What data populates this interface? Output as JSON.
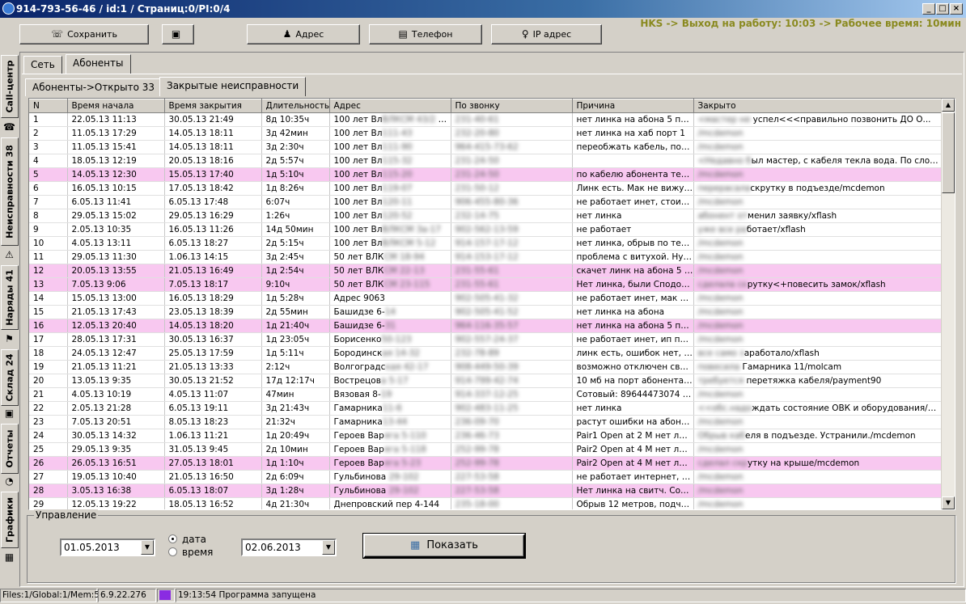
{
  "window": {
    "title": "914-793-56-46 / id:1 / Страниц:0/PI:0/4",
    "hks": "HKS -> Выход на работу: 10:03 -> Рабочее время: 10мин"
  },
  "toolbar": {
    "save": "Сохранить",
    "address": "Адрес",
    "phone": "Телефон",
    "ip": "IP адрес"
  },
  "vtabs": [
    "Call-центр",
    "Неисправности 38",
    "Наряды 41",
    "Склад 24",
    "Отчеты",
    "Графики"
  ],
  "tabs": {
    "net": "Сеть",
    "subscribers": "Абоненты",
    "open": "Абоненты->Открыто 33",
    "closed": "Закрытые неисправности"
  },
  "table": {
    "columns": [
      "N",
      "Время начала",
      "Время закрытия",
      "Длительность",
      "Адрес",
      "По звонку",
      "Причина",
      "Закрыто"
    ],
    "rows": [
      {
        "n": "1",
        "start": "22.05.13 11:13",
        "end": "30.05.13 21:49",
        "dur": "8д 10:35ч",
        "addr": "100 лет Вл",
        "addrb": "ВЛКСМ 43/2 кв.",
        "call": "231-40-61",
        "reason": "нет линка на абона 5 порт",
        "closedb": "<мастер не ",
        "closed": "успел<<<правильно позвонить ДО О...",
        "pink": false
      },
      {
        "n": "2",
        "start": "11.05.13 17:29",
        "end": "14.05.13 18:11",
        "dur": "3д 42мин",
        "addr": "100 лет Вл",
        "addrb": "111-43",
        "call": "232-20-80",
        "reason": "нет линка на хаб порт 1",
        "closedb": "/mcdemon",
        "closed": "",
        "pink": false
      },
      {
        "n": "3",
        "start": "11.05.13 15:41",
        "end": "14.05.13 18:11",
        "dur": "3д 2:30ч",
        "addr": "100 лет Вл",
        "addrb": "111-90",
        "call": "964-415-73-62",
        "reason": "переобжать кабель, поз...",
        "closedb": "/mcdemon",
        "closed": "",
        "pink": false
      },
      {
        "n": "4",
        "start": "18.05.13 12:19",
        "end": "20.05.13 18:16",
        "dur": "2д 5:57ч",
        "addr": "100 лет Вл",
        "addrb": "115-32",
        "call": "231-24-50",
        "reason": "",
        "closedb": "<Недавно б",
        "closed": "ыл мастер, с кабеля текла вода. По слов...",
        "pink": false
      },
      {
        "n": "5",
        "start": "14.05.13 12:30",
        "end": "15.05.13 17:40",
        "dur": "1д 5:10ч",
        "addr": "100 лет Вл",
        "addrb": "115-20",
        "call": "231-24-50",
        "reason": "по кабелю абонента теке...",
        "closedb": "/mcdemon",
        "closed": "",
        "pink": true
      },
      {
        "n": "6",
        "start": "16.05.13 10:15",
        "end": "17.05.13 18:42",
        "dur": "1д 8:26ч",
        "addr": "100 лет Вл",
        "addrb": "119-07",
        "call": "231-50-12",
        "reason": "Линк есть. Мак не вижу. ...",
        "closedb": "перерасала",
        "closed": "скрутку в подъезде/mcdemon",
        "pink": false
      },
      {
        "n": "7",
        "start": "6.05.13 11:41",
        "end": "6.05.13 17:48",
        "dur": "6:07ч",
        "addr": "100 лет Вл",
        "addrb": "120-11",
        "call": "906-455-80-36",
        "reason": "не работает инет, стоит х...",
        "closedb": "/mcdemon",
        "closed": "",
        "pink": false
      },
      {
        "n": "8",
        "start": "29.05.13 15:02",
        "end": "29.05.13 16:29",
        "dur": "1:26ч",
        "addr": "100 лет Вл",
        "addrb": "120-52",
        "call": "232-14-75",
        "reason": "нет линка",
        "closedb": "абонент от",
        "closed": "менил заявку/xflash",
        "pink": false
      },
      {
        "n": "9",
        "start": "2.05.13 10:35",
        "end": "16.05.13 11:26",
        "dur": "14д 50мин",
        "addr": "100 лет Вл",
        "addrb": "ВЛКСМ 3а-17",
        "call": "902-562-13-59",
        "reason": "не работает",
        "closedb": "уже все ра",
        "closed": "ботает/xflash",
        "pink": false
      },
      {
        "n": "10",
        "start": "4.05.13 13:11",
        "end": "6.05.13 18:27",
        "dur": "2д 5:15ч",
        "addr": "100 лет Вл",
        "addrb": "ВЛКСМ 5-12",
        "call": "914-157-17-12",
        "reason": "нет линка, обрыв по тест...",
        "closedb": "/mcdemon",
        "closed": "",
        "pink": false
      },
      {
        "n": "11",
        "start": "29.05.13 11:30",
        "end": "1.06.13 14:15",
        "dur": "3д 2:45ч",
        "addr": "50 лет ВЛК",
        "addrb": "СМ 18-94",
        "call": "914-153-17-12",
        "reason": "проблема с витухой. Нуж...",
        "closedb": "/mcdemon",
        "closed": "",
        "pink": false
      },
      {
        "n": "12",
        "start": "20.05.13 13:55",
        "end": "21.05.13 16:49",
        "dur": "1д 2:54ч",
        "addr": "50 лет ВЛК",
        "addrb": "СМ 22-13",
        "call": "231-55-61",
        "reason": "скачет линк на абона 5 п...",
        "closedb": "/mcdemon",
        "closed": "",
        "pink": true
      },
      {
        "n": "13",
        "start": "7.05.13 9:06",
        "end": "7.05.13 18:17",
        "dur": "9:10ч",
        "addr": "50 лет ВЛК",
        "addrb": "СМ 23-115",
        "call": "231-55-61",
        "reason": "Нет линка, были Сподоб...",
        "closedb": "сделала ск",
        "closed": "рутку<+повесить замок/xflash",
        "pink": true
      },
      {
        "n": "14",
        "start": "15.05.13 13:00",
        "end": "16.05.13 18:29",
        "dur": "1д 5:28ч",
        "addr": "Адрес 9063",
        "addrb": "",
        "call": "902-505-41-32",
        "reason": "не работает инет, мак ви...",
        "closedb": "/mcdemon",
        "closed": "",
        "pink": false
      },
      {
        "n": "15",
        "start": "21.05.13 17:43",
        "end": "23.05.13 18:39",
        "dur": "2д 55мин",
        "addr": "Башидзе 6-",
        "addrb": "14",
        "call": "902-505-41-52",
        "reason": "нет линка на абона",
        "closedb": "/mcdemon",
        "closed": "",
        "pink": false
      },
      {
        "n": "16",
        "start": "12.05.13 20:40",
        "end": "14.05.13 18:20",
        "dur": "1д 21:40ч",
        "addr": "Башидзе 6-",
        "addrb": "31",
        "call": "964-116-35-57",
        "reason": "нет линка  на абона 5 порт",
        "closedb": "/mcdemon",
        "closed": "",
        "pink": true
      },
      {
        "n": "17",
        "start": "28.05.13 17:31",
        "end": "30.05.13 16:37",
        "dur": "1д 23:05ч",
        "addr": "Борисенко",
        "addrb": "50-123",
        "call": "902-557-24-37",
        "reason": "не работает инет, ип пол...",
        "closedb": "/mcdemon",
        "closed": "",
        "pink": false
      },
      {
        "n": "18",
        "start": "24.05.13 12:47",
        "end": "25.05.13 17:59",
        "dur": "1д 5:11ч",
        "addr": "Бородинск",
        "addrb": "ая 14-32",
        "call": "232-78-89",
        "reason": "линк есть, ошибок нет, г...",
        "closedb": "все само з",
        "closed": "аработало/xflash",
        "pink": false
      },
      {
        "n": "19",
        "start": "21.05.13 11:21",
        "end": "21.05.13 13:33",
        "dur": "2:12ч",
        "addr": "Волгоградс",
        "addrb": "кая 42-17",
        "call": "908-449-50-39",
        "reason": "возможно отключен свет...",
        "closedb": "повесила",
        "closed": " Гамарника 11/molcam",
        "pink": false
      },
      {
        "n": "20",
        "start": "13.05.13 9:35",
        "end": "30.05.13 21:52",
        "dur": "17д 12:17ч",
        "addr": "Вострецов",
        "addrb": "а 5-17",
        "call": "914-799-42-74",
        "reason": "10 мб на порт абонента 5...",
        "closedb": "требуется",
        "closed": " перетяжка кабеля/payment90",
        "pink": false
      },
      {
        "n": "21",
        "start": "4.05.13 10:19",
        "end": "4.05.13 11:07",
        "dur": "47мин",
        "addr": "Вязовая 8-",
        "addrb": "19",
        "call": "914-337-12-25",
        "reason": "Сотовый: 89644473074 Л...",
        "closedb": "/mcdemon",
        "closed": "",
        "pink": false
      },
      {
        "n": "22",
        "start": "2.05.13 21:28",
        "end": "6.05.13 19:11",
        "dur": "3д 21:43ч",
        "addr": "Гамарника",
        "addrb": "11-6",
        "call": "902-483-11-25",
        "reason": "нет линка",
        "closedb": "<<обс.надо",
        "closed": "ждать состояние ОВК и оборудования/mcde...",
        "pink": false
      },
      {
        "n": "23",
        "start": "7.05.13 20:51",
        "end": "8.05.13 18:23",
        "dur": "21:32ч",
        "addr": "Гамарника",
        "addrb": "13-44",
        "call": "236-09-70",
        "reason": "растут ошибки на абонен...",
        "closedb": "/mcdemon",
        "closed": "",
        "pink": false
      },
      {
        "n": "24",
        "start": "30.05.13 14:32",
        "end": "1.06.13 11:21",
        "dur": "1д 20:49ч",
        "addr": "Героев Вар",
        "addrb": "яга 5-110",
        "call": "236-46-73",
        "reason": "Pair1 Open at 2 M нет лин...",
        "closedb": "Обрыв каб",
        "closed": "еля в подъезде. Устранили./mcdemon",
        "pink": false
      },
      {
        "n": "25",
        "start": "29.05.13 9:35",
        "end": "31.05.13 9:45",
        "dur": "2д 10мин",
        "addr": "Героев Вар",
        "addrb": "яга 5-118",
        "call": "252-99-78",
        "reason": "Pair2 Open at 4 M нет лин...",
        "closedb": "/mcdemon",
        "closed": "",
        "pink": false
      },
      {
        "n": "26",
        "start": "26.05.13 16:51",
        "end": "27.05.13 18:01",
        "dur": "1д 1:10ч",
        "addr": "Героев Вар",
        "addrb": "яга 5-23",
        "call": "252-99-78",
        "reason": "Pair2 Open at 4 M нет лин...",
        "closedb": "сделал скр",
        "closed": "утку на крыше/mcdemon",
        "pink": true
      },
      {
        "n": "27",
        "start": "19.05.13 10:40",
        "end": "21.05.13 16:50",
        "dur": "2д 6:09ч",
        "addr": "Гульбинова",
        "addrb": " 29-102",
        "call": "227-53-58",
        "reason": "не работает интернет, в ...",
        "closedb": "/mcdemon",
        "closed": "",
        "pink": false
      },
      {
        "n": "28",
        "start": "3.05.13 16:38",
        "end": "6.05.13 18:07",
        "dur": "3д 1:28ч",
        "addr": "Гульбинова",
        "addrb": " 29-102",
        "call": "227-53-58",
        "reason": "Нет линка на свитч. Сото...",
        "closedb": "/mcdemon",
        "closed": "",
        "pink": true
      },
      {
        "n": "29",
        "start": "12.05.13 19:22",
        "end": "18.05.13 16:52",
        "dur": "4д 21:30ч",
        "addr": "Днепровский пер 4-144",
        "addrb": "",
        "call": "235-18-00",
        "reason": "Обрыв 12 метров, подча...",
        "closedb": "/mcdemon",
        "closed": "",
        "pink": false
      }
    ]
  },
  "controls": {
    "group_label": "Управление",
    "date_from": "01.05.2013",
    "date_to": "02.06.2013",
    "radio_date": "дата",
    "radio_time": "время",
    "show": "Показать"
  },
  "status": {
    "files": "Files:1/Global:1/Mem:5",
    "version": "6.9.22.276",
    "message": "19:13:54 Программа запущена"
  }
}
